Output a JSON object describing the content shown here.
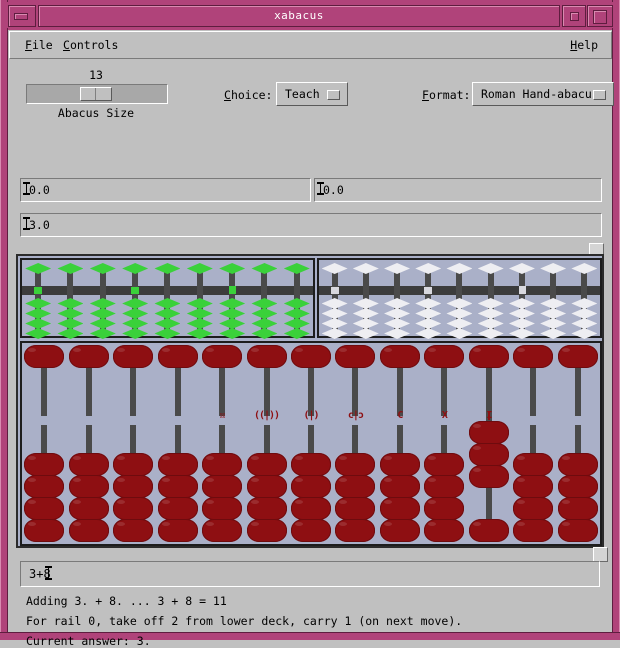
{
  "window": {
    "title": "xabacus",
    "title_color": "#b0437a",
    "buttons": [
      "minimize-box",
      "maximize-small-box",
      "maximize-box"
    ]
  },
  "menu": {
    "items": [
      {
        "label": "File",
        "mnemonic": "F"
      },
      {
        "label": "Controls",
        "mnemonic": "C"
      }
    ],
    "help": {
      "label": "Help",
      "mnemonic": "H"
    }
  },
  "controls": {
    "size_value": "13",
    "size_label": "Abacus Size",
    "slider_percent": 48,
    "choice": {
      "label": "Choice:",
      "mnemonic": "C",
      "value": "Teach"
    },
    "format": {
      "label": "Format:",
      "mnemonic": "F",
      "value": "Roman Hand-abacus"
    }
  },
  "entries": {
    "left": "0.0",
    "right": "0.0",
    "result": "3.0"
  },
  "abacus": {
    "rail_labels": [
      "",
      "",
      "",
      "",
      "☒",
      "((|))",
      "(|)",
      "c|ɔ",
      "C",
      "X",
      "I",
      "",
      ""
    ],
    "rail_count": 13,
    "active_rail_index": 10,
    "active_rail_beads_up": 3,
    "bead_color": "#8e0f12",
    "deck_color": "#aab0c8",
    "mini_green_rails": 9,
    "mini_white_rails": 9,
    "mini_green_bead_color": "#3ad13a",
    "mini_white_bead_color": "#eeeef2",
    "rod_color": "#f0b800"
  },
  "command": {
    "value": "3+8",
    "placeholder": ""
  },
  "status": [
    "Adding 3. + 8. ... 3 + 8 = 11",
    "For rail 0, take off 2 from lower deck, carry 1 (on next move).",
    "Current answer: 3."
  ]
}
